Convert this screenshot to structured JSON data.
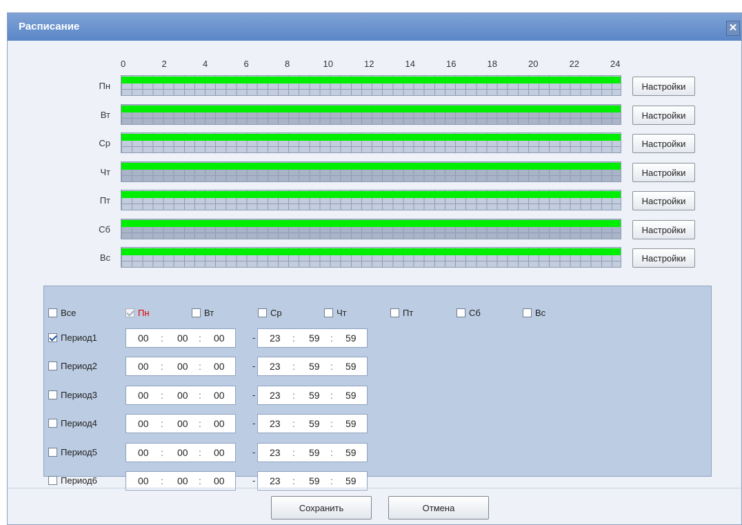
{
  "dialog": {
    "title": "Расписание",
    "close_glyph": "✕"
  },
  "timeline": {
    "hour_labels": [
      "0",
      "2",
      "4",
      "6",
      "8",
      "10",
      "12",
      "14",
      "16",
      "18",
      "20",
      "22",
      "24"
    ],
    "settings_label": "Настройки",
    "days": [
      {
        "label": "Пн",
        "active_from_hour": 0,
        "active_to_hour": 24
      },
      {
        "label": "Вт",
        "active_from_hour": 0,
        "active_to_hour": 24
      },
      {
        "label": "Ср",
        "active_from_hour": 0,
        "active_to_hour": 24
      },
      {
        "label": "Чт",
        "active_from_hour": 0,
        "active_to_hour": 24
      },
      {
        "label": "Пт",
        "active_from_hour": 0,
        "active_to_hour": 24
      },
      {
        "label": "Сб",
        "active_from_hour": 0,
        "active_to_hour": 24
      },
      {
        "label": "Вс",
        "active_from_hour": 0,
        "active_to_hour": 24
      }
    ],
    "active_color": "#00ee00"
  },
  "day_selector": {
    "all_label": "Все",
    "all_checked": false,
    "days": [
      {
        "label": "Пн",
        "checked": true,
        "disabled": true,
        "highlight": true
      },
      {
        "label": "Вт",
        "checked": false
      },
      {
        "label": "Ср",
        "checked": false
      },
      {
        "label": "Чт",
        "checked": false
      },
      {
        "label": "Пт",
        "checked": false
      },
      {
        "label": "Сб",
        "checked": false
      },
      {
        "label": "Вс",
        "checked": false
      }
    ]
  },
  "periods": [
    {
      "label": "Период1",
      "checked": true,
      "start": [
        "00",
        "00",
        "00"
      ],
      "end": [
        "23",
        "59",
        "59"
      ]
    },
    {
      "label": "Период2",
      "checked": false,
      "start": [
        "00",
        "00",
        "00"
      ],
      "end": [
        "23",
        "59",
        "59"
      ]
    },
    {
      "label": "Период3",
      "checked": false,
      "start": [
        "00",
        "00",
        "00"
      ],
      "end": [
        "23",
        "59",
        "59"
      ]
    },
    {
      "label": "Период4",
      "checked": false,
      "start": [
        "00",
        "00",
        "00"
      ],
      "end": [
        "23",
        "59",
        "59"
      ]
    },
    {
      "label": "Период5",
      "checked": false,
      "start": [
        "00",
        "00",
        "00"
      ],
      "end": [
        "23",
        "59",
        "59"
      ]
    },
    {
      "label": "Период6",
      "checked": false,
      "start": [
        "00",
        "00",
        "00"
      ],
      "end": [
        "23",
        "59",
        "59"
      ]
    }
  ],
  "time_separator": ":",
  "range_separator": "-",
  "footer": {
    "save_label": "Сохранить",
    "cancel_label": "Отмена"
  }
}
